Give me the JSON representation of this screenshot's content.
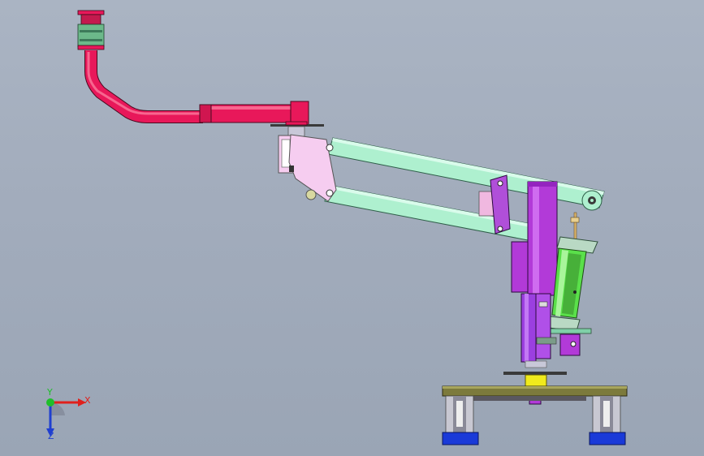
{
  "view": {
    "background_top": "#aab4c3",
    "background_bottom": "#9aa5b5"
  },
  "triad": {
    "x_label": "X",
    "y_label": "Y",
    "z_label": "Z",
    "x_color": "#e0201c",
    "y_color": "#1fbf2a",
    "z_color": "#1f3fd0"
  },
  "model": {
    "parts": [
      {
        "name": "swivel-flange",
        "color": "#6cb98a"
      },
      {
        "name": "bent-pipe",
        "color": "#e8185a"
      },
      {
        "name": "horizontal-arm",
        "color": "#e8185a"
      },
      {
        "name": "parallel-link-upper",
        "color": "#aef0cf"
      },
      {
        "name": "parallel-link-lower",
        "color": "#aef0cf"
      },
      {
        "name": "head-plate",
        "color": "#f6cdf0"
      },
      {
        "name": "pivot-plate",
        "color": "#b04fd9"
      },
      {
        "name": "vertical-column",
        "color": "#b23ad8"
      },
      {
        "name": "pneumatic-cylinder",
        "color": "#5ae04a"
      },
      {
        "name": "lower-column",
        "color": "#9b3fe0"
      },
      {
        "name": "slew-bearing",
        "color": "#f0ea1c"
      },
      {
        "name": "base-plate",
        "color": "#7c7a3c"
      },
      {
        "name": "foot-block",
        "color": "#1a3ad8"
      }
    ]
  }
}
